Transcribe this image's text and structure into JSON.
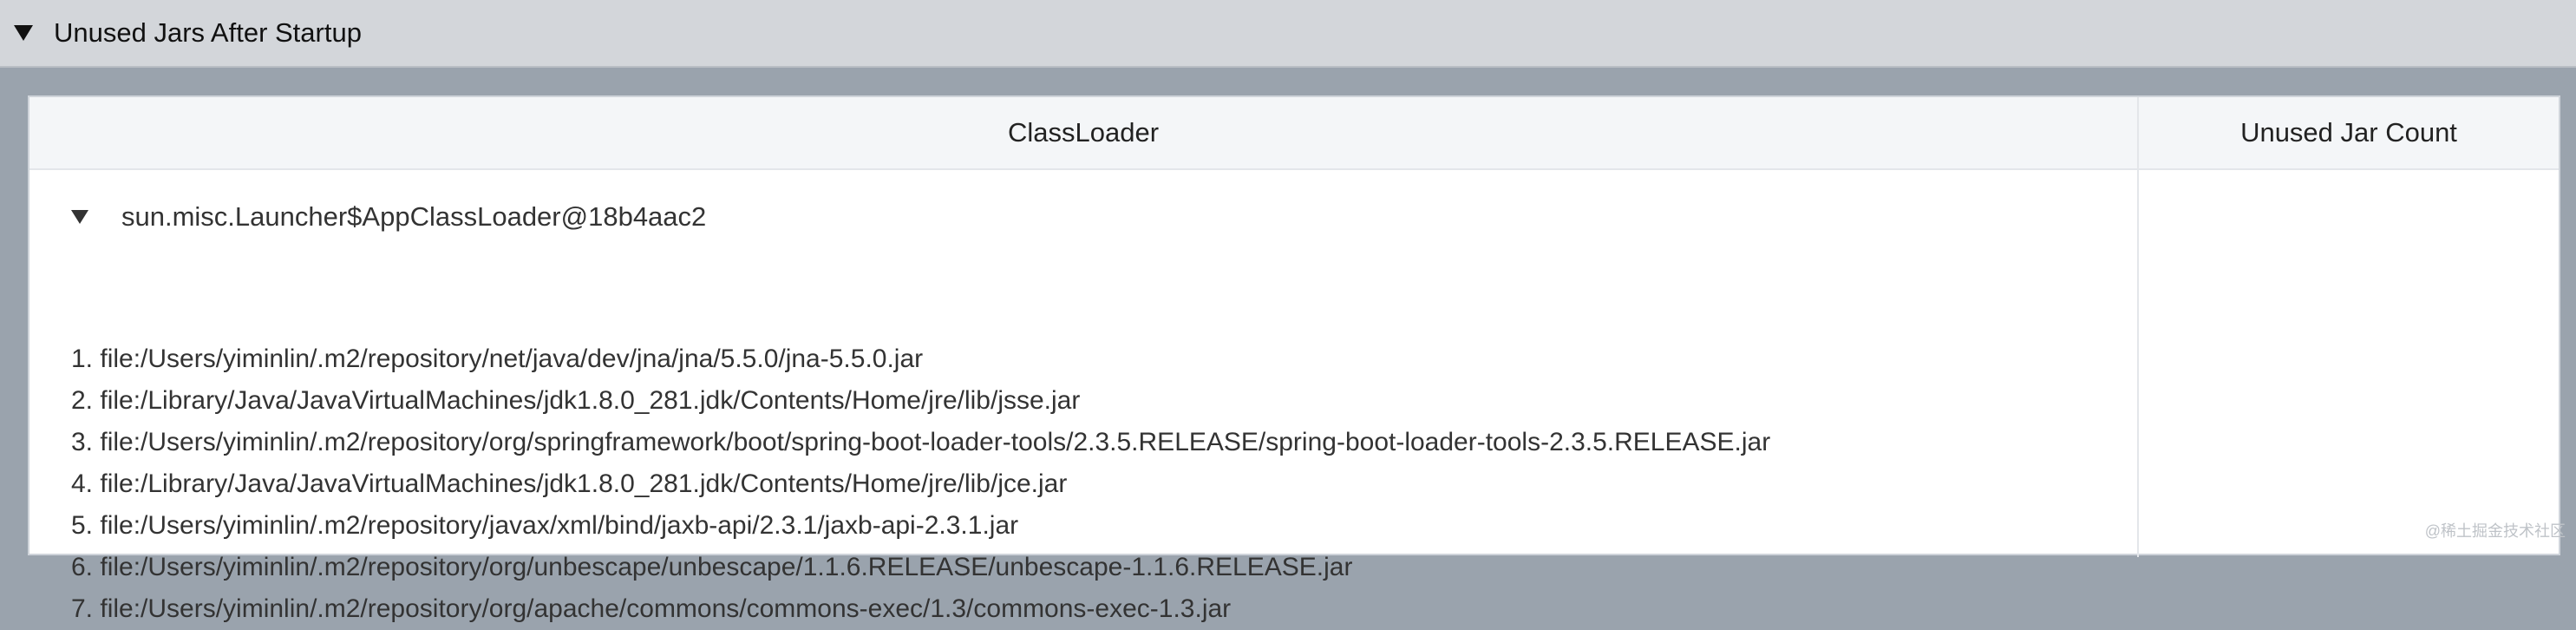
{
  "section": {
    "title": "Unused Jars After Startup"
  },
  "table": {
    "headers": {
      "classloader": "ClassLoader",
      "count": "Unused Jar Count"
    },
    "rows": [
      {
        "loader": "sun.misc.Launcher$AppClassLoader@18b4aac2",
        "jars": [
          "1. file:/Users/yiminlin/.m2/repository/net/java/dev/jna/jna/5.5.0/jna-5.5.0.jar",
          "2. file:/Library/Java/JavaVirtualMachines/jdk1.8.0_281.jdk/Contents/Home/jre/lib/jsse.jar",
          "3. file:/Users/yiminlin/.m2/repository/org/springframework/boot/spring-boot-loader-tools/2.3.5.RELEASE/spring-boot-loader-tools-2.3.5.RELEASE.jar",
          "4. file:/Library/Java/JavaVirtualMachines/jdk1.8.0_281.jdk/Contents/Home/jre/lib/jce.jar",
          "5. file:/Users/yiminlin/.m2/repository/javax/xml/bind/jaxb-api/2.3.1/jaxb-api-2.3.1.jar",
          "6. file:/Users/yiminlin/.m2/repository/org/unbescape/unbescape/1.1.6.RELEASE/unbescape-1.1.6.RELEASE.jar",
          "7. file:/Users/yiminlin/.m2/repository/org/apache/commons/commons-exec/1.3/commons-exec-1.3.jar"
        ]
      }
    ]
  },
  "watermark": "@稀土掘金技术社区"
}
